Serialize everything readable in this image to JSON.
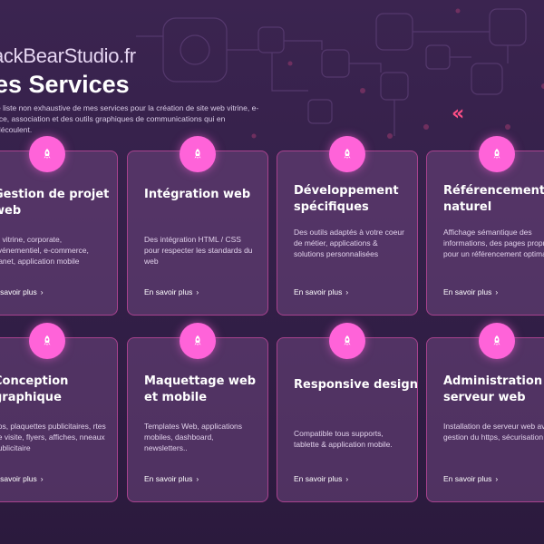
{
  "header": {
    "brand": "ackBearStudio.fr",
    "title": "es Services",
    "intro": "e liste non exhaustive de mes services pour la création de site web vitrine, e-rce, association et des outils graphiques de communications qui en découlent.",
    "chevron": "«"
  },
  "colors": {
    "accent": "#ff63d9",
    "card_border": "#a8428e",
    "background": "#362248"
  },
  "icons": {
    "badge": "rocket-icon",
    "link_arrow": "chevron-right-icon"
  },
  "services": [
    {
      "title": "Gestion de projet web",
      "description": "te vitrine, corporate, événementiel, e-commerce, tranet, application mobile",
      "link": "n savoir plus",
      "arrow": "›"
    },
    {
      "title": "Intégration web",
      "description": "Des intégration HTML / CSS pour respecter les standards du web",
      "link": "En savoir plus",
      "arrow": "›"
    },
    {
      "title": "Développement spécifiques",
      "description": "Des outils adaptés à votre coeur de métier, applications & solutions personnalisées",
      "link": "En savoir plus",
      "arrow": "›"
    },
    {
      "title": "Référencement naturel",
      "description": "Affichage sémantique des informations, des pages propres pour un référencement optimal",
      "link": "En savoir plus",
      "arrow": "›"
    },
    {
      "title": "Conception graphique",
      "description": "gos, plaquettes publicitaires, rtes de visite, flyers, affiches, nneaux publicitaire",
      "link": "n savoir plus",
      "arrow": "›"
    },
    {
      "title": "Maquettage web et mobile",
      "description": "Templates Web, applications mobiles, dashboard, newsletters..",
      "link": "En savoir plus",
      "arrow": "›"
    },
    {
      "title": "Responsive design",
      "description": "Compatible tous supports, tablette & application mobile.",
      "link": "En savoir plus",
      "arrow": "›"
    },
    {
      "title": "Administration serveur web",
      "description": "Installation de serveur web avec gestion du https, sécurisation etc",
      "link": "En savoir plus",
      "arrow": "›"
    }
  ]
}
